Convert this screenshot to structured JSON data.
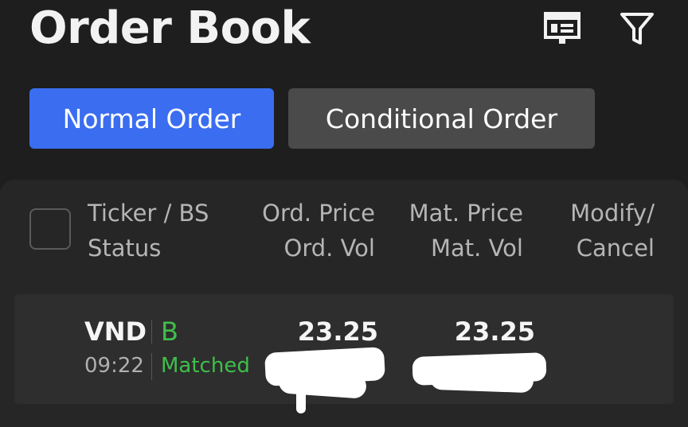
{
  "header": {
    "title": "Order Book",
    "icons": [
      "layout-icon",
      "filter-icon"
    ]
  },
  "tabs": [
    {
      "label": "Normal Order",
      "active": true
    },
    {
      "label": "Conditional Order",
      "active": false
    }
  ],
  "columns": {
    "ticker": [
      "Ticker / BS",
      "Status"
    ],
    "ord": [
      "Ord. Price",
      "Ord. Vol"
    ],
    "mat": [
      "Mat. Price",
      "Mat. Vol"
    ],
    "action": [
      "Modify/",
      "Cancel"
    ]
  },
  "orders": [
    {
      "ticker": "VND",
      "side": "B",
      "time": "09:22",
      "status": "Matched",
      "ord_price": "23.25",
      "mat_price": "23.25"
    }
  ],
  "colors": {
    "accent": "#3a6df0",
    "buy": "#3fbf4a",
    "background": "#1e1e1e",
    "panel": "#262626"
  }
}
